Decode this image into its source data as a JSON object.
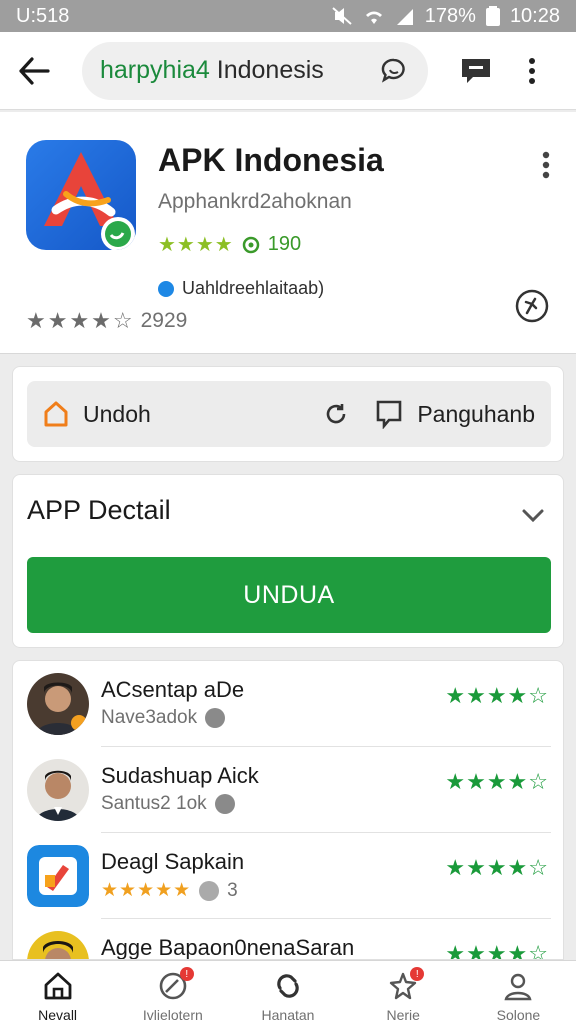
{
  "status_bar": {
    "time_left": "U:518",
    "battery": "178%",
    "time_right": "10:28"
  },
  "top_bar": {
    "search_prefix": "harpyhia4",
    "search_suffix": " Indonesis"
  },
  "app": {
    "title": "APK Indonesia",
    "subtitle": "Apphankrd2ahoknan",
    "rating_count": "190",
    "developer": "Uahldreehlaitaab)",
    "total_rating": "2929",
    "logo_colors": {
      "bg": "#1e6fe0",
      "accent_red": "#e8443a",
      "accent_orange": "#f7a21b",
      "badge": "#2aa84a"
    }
  },
  "actions": {
    "left_label": "Undoh",
    "right_label": "Panguhanb"
  },
  "detail": {
    "title": "APP Dectail",
    "download_label": "UNDUA"
  },
  "reviews": [
    {
      "name": "ACsentap aDe",
      "meta": "Nave3adok",
      "stars": "★★★★☆"
    },
    {
      "name": "Sudashuap Aick",
      "meta": "Santus2 1ok",
      "stars": "★★★★☆"
    },
    {
      "name": "Deagl Sapkain",
      "meta": "3",
      "stars": "★★★★☆"
    },
    {
      "name": "Agge Bapaon0nenaSaran",
      "meta": "",
      "stars": "★★★★☆"
    }
  ],
  "nav": [
    {
      "label": "Nevall"
    },
    {
      "label": "Ivlielotern"
    },
    {
      "label": "Hanatan"
    },
    {
      "label": "Nerie"
    },
    {
      "label": "Solone"
    }
  ],
  "colors": {
    "primary_green": "#1f9c3e",
    "star_green": "#1a9a3a",
    "badge_red": "#e53935"
  }
}
